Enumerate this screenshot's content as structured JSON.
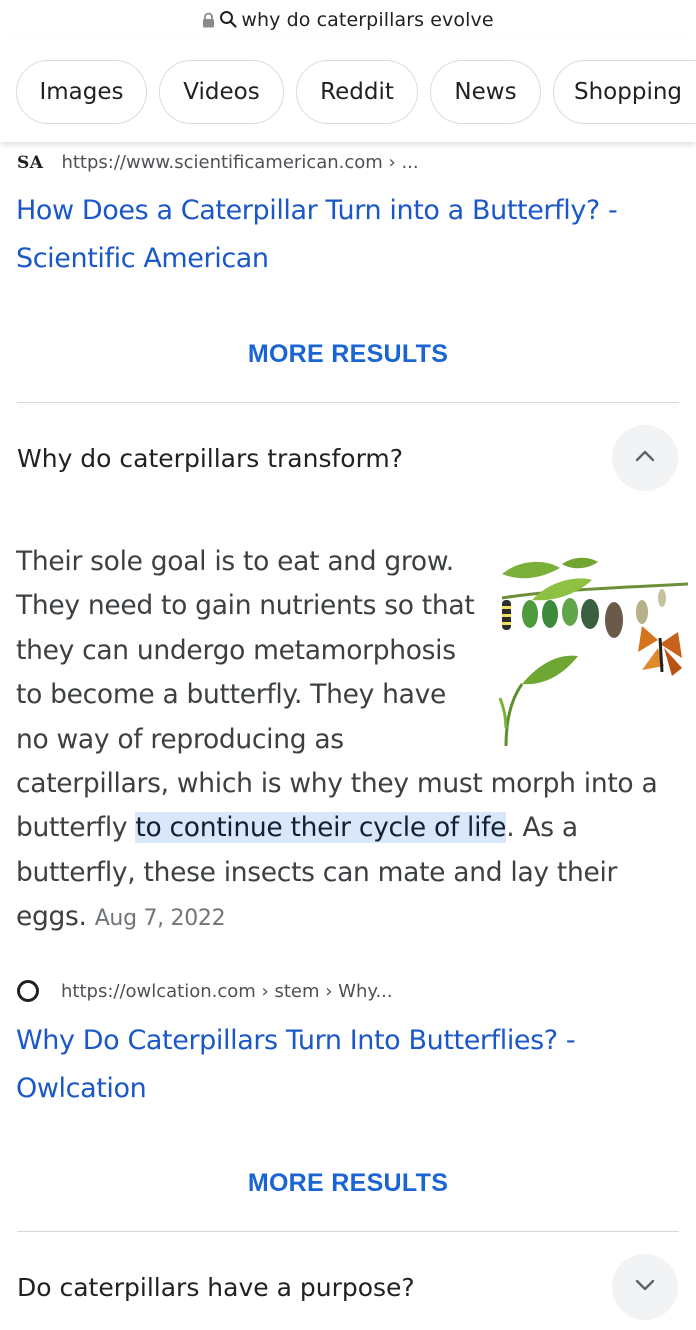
{
  "url_bar": {
    "query": "why do caterpillars evolve"
  },
  "chips": [
    "Images",
    "Videos",
    "Reddit",
    "News",
    "Shopping"
  ],
  "result1": {
    "source_logo": "SA",
    "url": "https://www.scientificamerican.com › ...",
    "title": "How Does a Caterpillar Turn into a Butterfly? - Scientific American"
  },
  "more_results_label": "MORE RESULTS",
  "question1": {
    "text": "Why do caterpillars transform?",
    "state": "expanded",
    "answer_before": "Their sole goal is to eat and grow. They need to gain nutrients so that they can undergo metamorphosis to become a butterfly. They have no way of reproducing as caterpillars, which is why they must morph into a butterfly ",
    "answer_highlight": "to continue their cycle of life",
    "answer_after": ". As a butterfly, these insects can mate and lay their eggs.",
    "date": "Aug 7, 2022",
    "image_icon": "butterfly-life-cycle-image"
  },
  "result2": {
    "source_logo": "O",
    "url": "https://owlcation.com › stem › Why...",
    "title": "Why Do Caterpillars Turn Into Butterflies? - Owlcation"
  },
  "question2": {
    "text": "Do caterpillars have a purpose?",
    "state": "collapsed"
  },
  "colors": {
    "link": "#1a57c9",
    "more_results": "#1a64d4",
    "highlight": "#d9e7fc"
  }
}
